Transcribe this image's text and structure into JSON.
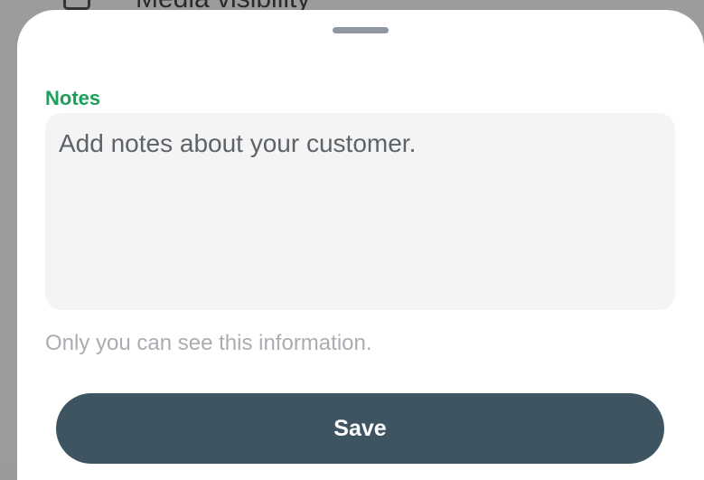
{
  "background_row": {
    "icon": "checkbox-icon",
    "label": "Media visibility"
  },
  "sheet": {
    "handle_icon": "drag-handle-icon",
    "notes_label": "Notes",
    "notes_placeholder": "Add notes about your customer.",
    "notes_value": "",
    "helper_text": "Only you can see this information.",
    "save_label": "Save"
  },
  "colors": {
    "accent_green": "#1aa058",
    "button_bg": "#3f5461",
    "field_bg": "#f4f4f4"
  }
}
